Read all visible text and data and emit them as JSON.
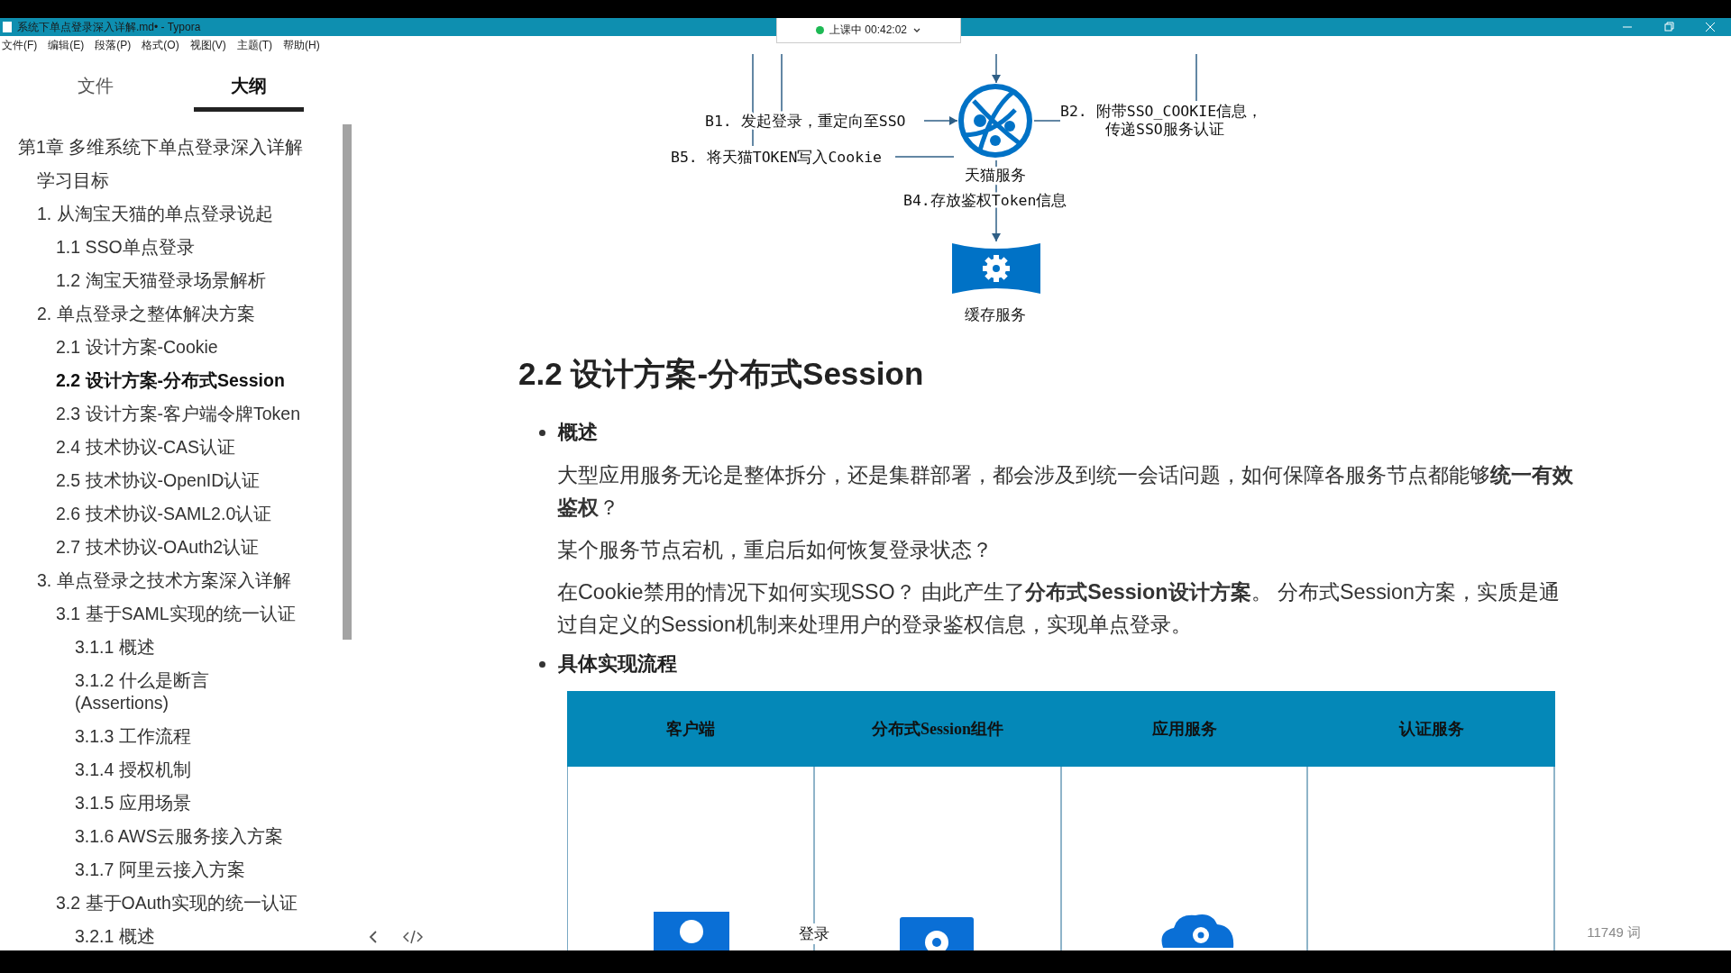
{
  "window": {
    "title": "系统下单点登录深入详解.md• - Typora",
    "recording": "上课中 00:42:02"
  },
  "menu": [
    "文件(F)",
    "编辑(E)",
    "段落(P)",
    "格式(O)",
    "视图(V)",
    "主题(T)",
    "帮助(H)"
  ],
  "sidebar": {
    "tabs": [
      {
        "label": "文件",
        "selected": false
      },
      {
        "label": "大纲",
        "selected": true
      }
    ],
    "outline": [
      {
        "text": "第1章 多维系统下单点登录深入详解",
        "selected": false,
        "children": [
          {
            "text": "学习目标",
            "selected": false
          },
          {
            "text": "1. 从淘宝天猫的单点登录说起",
            "selected": false,
            "children": [
              {
                "text": "1.1 SSO单点登录",
                "selected": false
              },
              {
                "text": "1.2 淘宝天猫登录场景解析",
                "selected": false
              }
            ]
          },
          {
            "text": "2. 单点登录之整体解决方案",
            "selected": false,
            "children": [
              {
                "text": "2.1 设计方案-Cookie",
                "selected": false
              },
              {
                "text": "2.2 设计方案-分布式Session",
                "selected": true
              },
              {
                "text": "2.3 设计方案-客户端令牌Token",
                "selected": false
              },
              {
                "text": "2.4 技术协议-CAS认证",
                "selected": false
              },
              {
                "text": "2.5 技术协议-OpenID认证",
                "selected": false
              },
              {
                "text": "2.6 技术协议-SAML2.0认证",
                "selected": false
              },
              {
                "text": "2.7 技术协议-OAuth2认证",
                "selected": false
              }
            ]
          },
          {
            "text": "3. 单点登录之技术方案深入详解",
            "selected": false,
            "children": [
              {
                "text": "3.1 基于SAML实现的统一认证",
                "selected": false,
                "children": [
                  {
                    "text": "3.1.1 概述",
                    "selected": false
                  },
                  {
                    "text": "3.1.2 什么是断言\n(Assertions)",
                    "selected": false
                  },
                  {
                    "text": "3.1.3 工作流程",
                    "selected": false
                  },
                  {
                    "text": "3.1.4 授权机制",
                    "selected": false
                  },
                  {
                    "text": "3.1.5 应用场景",
                    "selected": false
                  },
                  {
                    "text": "3.1.6 AWS云服务接入方案",
                    "selected": false
                  },
                  {
                    "text": "3.1.7 阿里云接入方案",
                    "selected": false
                  }
                ]
              },
              {
                "text": "3.2 基于OAuth实现的统一认证",
                "selected": false,
                "children": [
                  {
                    "text": "3.2.1 概述",
                    "selected": false
                  }
                ]
              }
            ]
          }
        ]
      }
    ]
  },
  "diagram": {
    "nodes": [
      {
        "kind": "globe",
        "label": "天猫服务"
      },
      {
        "kind": "cache",
        "label": "缓存服务"
      }
    ],
    "labels": [
      "B1. 发起登录，重定向至SSO",
      "B5. 将天猫TOKEN写入Cookie",
      "B2. 附带SSO_COOKIE信息，",
      "传递SSO服务认证",
      "B4.存放鉴权Token信息"
    ]
  },
  "document": {
    "heading": "2.2 设计方案-分布式Session",
    "sections": [
      {
        "bullet": "概述",
        "paragraphs": [
          "大型应用服务无论是整体拆分，还是集群部署，都会涉及到统一会话问题，如何保障各服务节点都能够**统一有效鉴权**？",
          "某个服务节点宕机，重启后如何恢复登录状态？",
          "在Cookie禁用的情况下如何实现SSO？ 由此产生了**分布式Session设计方案**。 分布式Session方案，实质是通过自定义的Session机制来处理用户的登录鉴权信息，实现单点登录。"
        ]
      },
      {
        "bullet": "具体实现流程"
      }
    ]
  },
  "flow_chart": {
    "lanes": [
      "客户端",
      "分布式Session组件",
      "应用服务",
      "认证服务"
    ],
    "nodes": [
      {
        "kind": "user"
      },
      {
        "kind": "gear"
      },
      {
        "kind": "cloud"
      }
    ],
    "edge_label": "登录"
  },
  "status_bar": {
    "word_count": "11749 词"
  }
}
